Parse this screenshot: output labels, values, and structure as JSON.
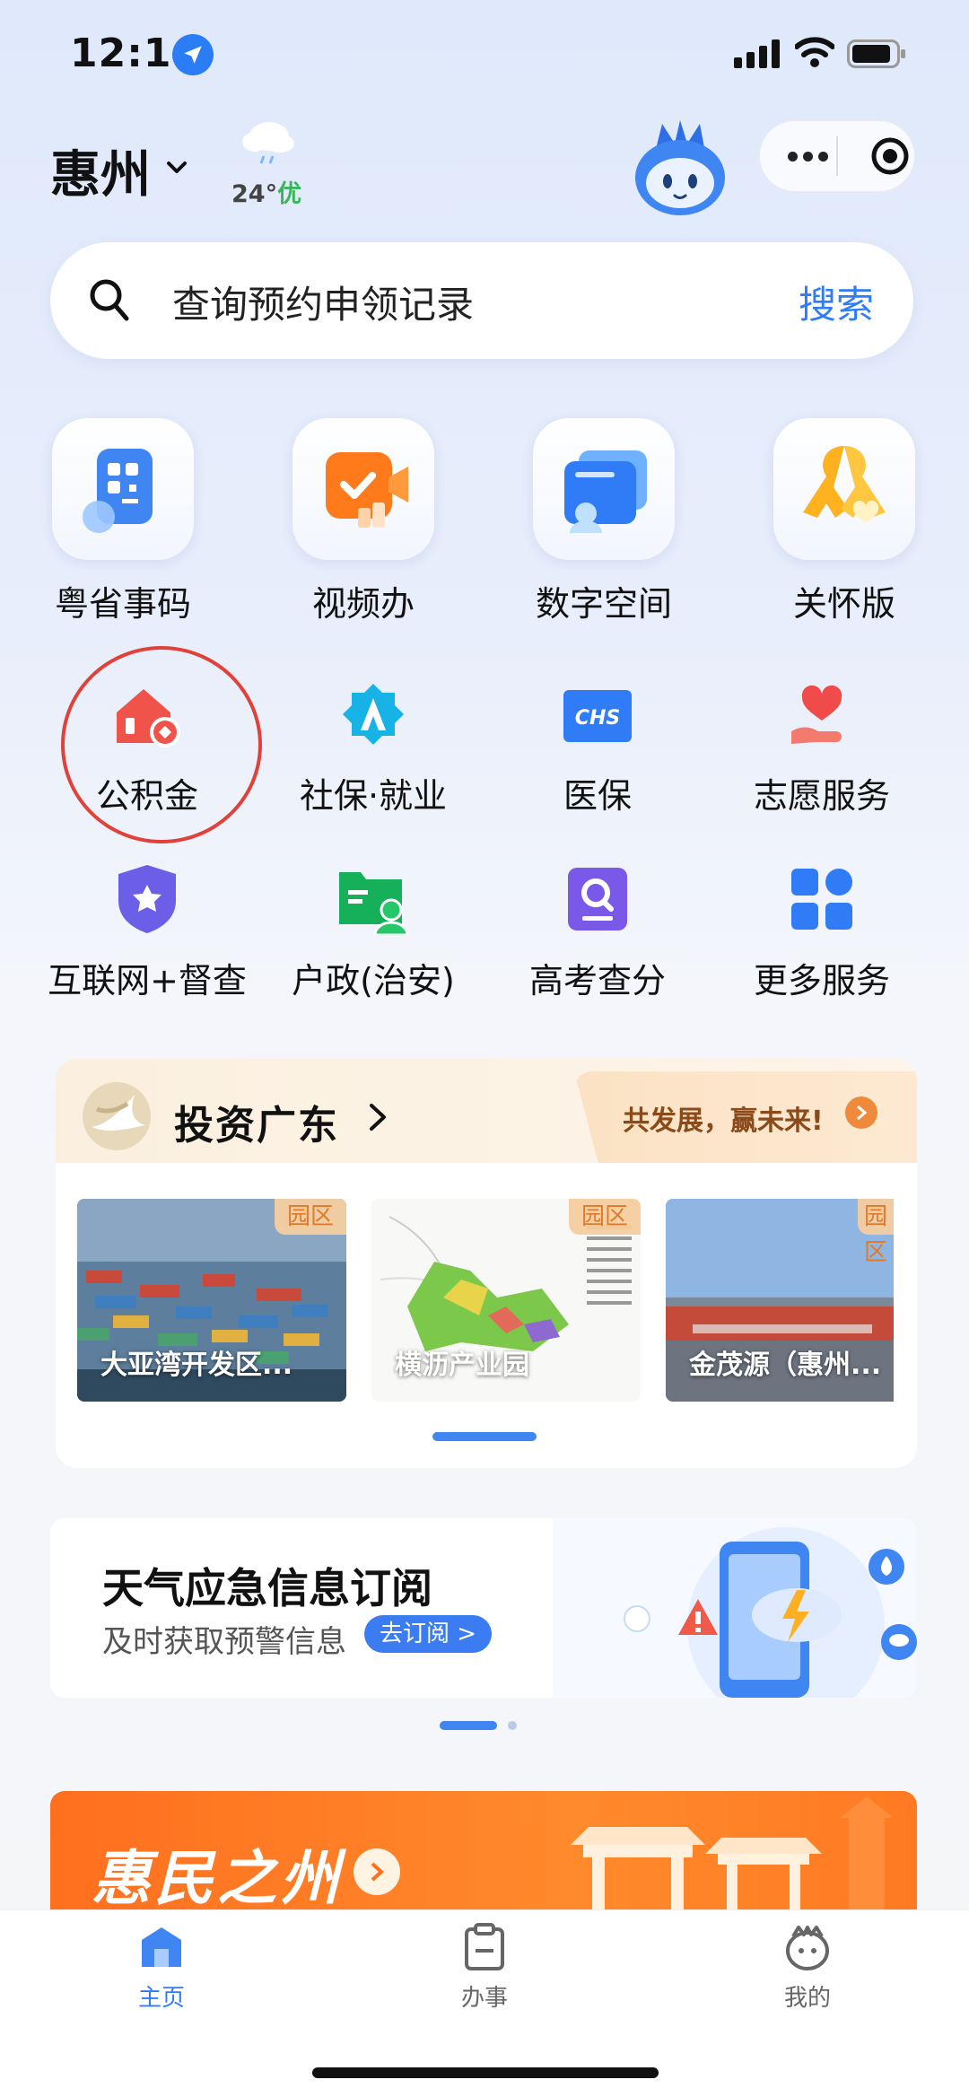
{
  "status_bar": {
    "time": "12:16"
  },
  "header": {
    "city": "惠州",
    "temperature": "24°",
    "air_quality": "优"
  },
  "search": {
    "placeholder": "查询预约申领记录",
    "button": "搜索"
  },
  "quick_tiles": [
    {
      "label": "粤省事码",
      "icon": "qr-code-icon"
    },
    {
      "label": "视频办",
      "icon": "video-call-icon"
    },
    {
      "label": "数字空间",
      "icon": "digital-space-icon"
    },
    {
      "label": "关怀版",
      "icon": "care-ribbon-icon"
    }
  ],
  "services": [
    {
      "label": "公积金",
      "icon": "housing-fund-icon",
      "highlighted": true
    },
    {
      "label": "社保·就业",
      "icon": "social-security-icon"
    },
    {
      "label": "医保",
      "icon": "medical-insurance-icon",
      "badge_text": "CHS"
    },
    {
      "label": "志愿服务",
      "icon": "volunteer-icon"
    },
    {
      "label": "互联网+督查",
      "icon": "supervision-shield-icon"
    },
    {
      "label": "户政(治安)",
      "icon": "household-registration-icon"
    },
    {
      "label": "高考查分",
      "icon": "exam-score-icon"
    },
    {
      "label": "更多服务",
      "icon": "more-services-icon"
    }
  ],
  "invest": {
    "title": "投资广东",
    "slogan": "共发展，赢未来!",
    "parks": [
      {
        "tag": "园区",
        "name": "大亚湾开发区..."
      },
      {
        "tag": "园区",
        "name": "横沥产业园"
      },
      {
        "tag": "园区",
        "name": "金茂源（惠州..."
      }
    ]
  },
  "weather_banner": {
    "title": "天气应急信息订阅",
    "subtitle": "及时获取预警信息",
    "button": "去订阅 >"
  },
  "promo_banner": {
    "title": "惠民之州"
  },
  "tabbar": [
    {
      "label": "主页",
      "active": true
    },
    {
      "label": "办事",
      "active": false
    },
    {
      "label": "我的",
      "active": false
    }
  ],
  "colors": {
    "accent": "#2f7cf6",
    "highlight_circle": "#e0413a",
    "promo": "#ff7a22"
  }
}
